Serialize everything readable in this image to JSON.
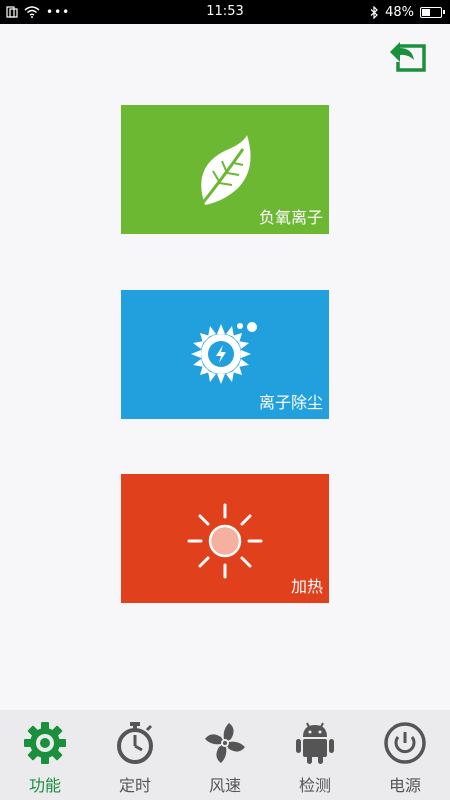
{
  "status_bar": {
    "time": "11:53",
    "battery_percent": "48%",
    "battery_level": 0.48,
    "icons": [
      "sim-icon",
      "wifi-icon",
      "more-dots-icon",
      "bluetooth-icon",
      "battery-icon"
    ]
  },
  "header": {
    "back_icon": "back-arrow-icon",
    "accent": "#1a8f3c"
  },
  "tiles": [
    {
      "label": "负氧离子",
      "icon": "leaf-icon",
      "color": "#6db833"
    },
    {
      "label": "离子除尘",
      "icon": "gear-bolt-icon",
      "color": "#22a0dd"
    },
    {
      "label": "加热",
      "icon": "sun-icon",
      "color": "#e0401c"
    }
  ],
  "tabs": [
    {
      "label": "功能",
      "icon": "gear-icon",
      "active": true
    },
    {
      "label": "定时",
      "icon": "stopwatch-icon",
      "active": false
    },
    {
      "label": "风速",
      "icon": "fan-icon",
      "active": false
    },
    {
      "label": "检测",
      "icon": "android-icon",
      "active": false
    },
    {
      "label": "电源",
      "icon": "power-icon",
      "active": false
    }
  ]
}
